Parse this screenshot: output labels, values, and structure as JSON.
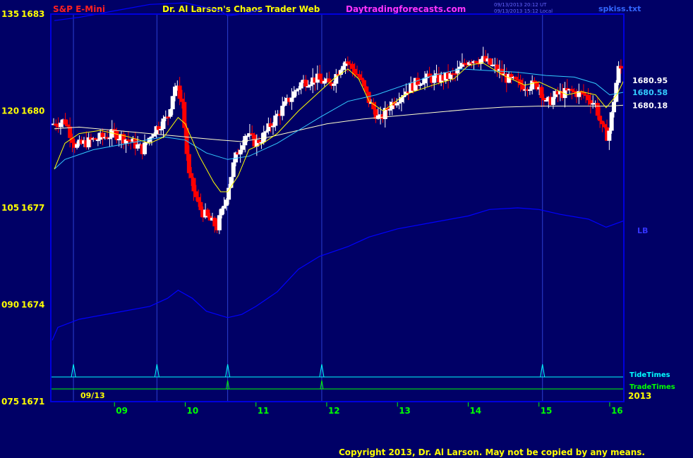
{
  "header": {
    "symbol": "S&P E-Mini",
    "title": "Dr. Al Larson's Chaos Trader Web",
    "website": "Daytradingforecasts.com",
    "timestamp_utc": "09/13/2013 20:12 UT",
    "timestamp_local": "09/13/2013 15:12 Local",
    "filename": "spkiss.txt"
  },
  "footer": {
    "copyright": "Copyright 2013, Dr. Al Larson. May not be copied by any means."
  },
  "chart_data": {
    "type": "candlestick",
    "date_label": "09/13",
    "year_label": "2013",
    "x_range": [
      8.1,
      16.2
    ],
    "x_ticks": [
      {
        "value": 9,
        "label": "09"
      },
      {
        "value": 10,
        "label": "10"
      },
      {
        "value": 11,
        "label": "11"
      },
      {
        "value": 12,
        "label": "12"
      },
      {
        "value": 13,
        "label": "13"
      },
      {
        "value": 14,
        "label": "14"
      },
      {
        "value": 15,
        "label": "15"
      },
      {
        "value": 16,
        "label": "16"
      }
    ],
    "y_range": [
      1671,
      1683
    ],
    "y_ticks": [
      {
        "value": 1683,
        "osc": "135",
        "price": "1683"
      },
      {
        "value": 1680,
        "osc": "120",
        "price": "1680"
      },
      {
        "value": 1677,
        "osc": "105",
        "price": "1677"
      },
      {
        "value": 1674,
        "osc": "090",
        "price": "1674"
      },
      {
        "value": 1671,
        "osc": "075",
        "price": "1671"
      }
    ],
    "colors": {
      "background": "#000066",
      "up_bar": "#ffffff",
      "down_bar": "#ff0000",
      "ma_fast": "#ffff00",
      "ma_mid": "#33ccff",
      "ma_slow": "#ffffcc",
      "oscillator": "#0000ff",
      "tide_times": "#00ffff",
      "trade_times": "#00ff00",
      "axis_green": "#00ff00",
      "axis_yellow": "#ffff00"
    },
    "vertical_lines_x": [
      8.42,
      9.6,
      10.6,
      11.93,
      15.05
    ],
    "tide_times": [
      8.42,
      9.6,
      10.6,
      11.93,
      15.05
    ],
    "trade_times": [
      10.6,
      11.93
    ],
    "tide_label": "TideTimes",
    "trade_label": "TradeTimes",
    "ma_labels": [
      {
        "text": "1680.95",
        "price": 1680.95,
        "color": "#ffffff"
      },
      {
        "text": "1680.58",
        "price": 1680.58,
        "color": "#33ccff"
      },
      {
        "text": "1680.18",
        "price": 1680.18,
        "color": "#ffffff"
      }
    ],
    "oscillator_label": "LB",
    "oscillator_label_price": 1676.3,
    "upper_band": [
      [
        8.15,
        1682.8
      ],
      [
        8.5,
        1682.9
      ],
      [
        9.0,
        1683.1
      ],
      [
        9.5,
        1683.3
      ],
      [
        10.0,
        1683.35
      ],
      [
        10.5,
        1683.1
      ],
      [
        10.6,
        1682.95
      ],
      [
        10.8,
        1683.0
      ],
      [
        11.1,
        1683.15
      ]
    ],
    "oscillator": [
      [
        8.12,
        1672.9
      ],
      [
        8.2,
        1673.3
      ],
      [
        8.5,
        1673.55
      ],
      [
        9.0,
        1673.75
      ],
      [
        9.5,
        1673.95
      ],
      [
        9.75,
        1674.2
      ],
      [
        9.9,
        1674.45
      ],
      [
        10.1,
        1674.2
      ],
      [
        10.3,
        1673.8
      ],
      [
        10.6,
        1673.6
      ],
      [
        10.8,
        1673.7
      ],
      [
        11.0,
        1673.95
      ],
      [
        11.3,
        1674.4
      ],
      [
        11.6,
        1675.1
      ],
      [
        11.9,
        1675.5
      ],
      [
        12.3,
        1675.8
      ],
      [
        12.6,
        1676.1
      ],
      [
        13.0,
        1676.35
      ],
      [
        13.5,
        1676.55
      ],
      [
        14.0,
        1676.75
      ],
      [
        14.3,
        1676.95
      ],
      [
        14.7,
        1677.0
      ],
      [
        15.0,
        1676.95
      ],
      [
        15.3,
        1676.8
      ],
      [
        15.7,
        1676.65
      ],
      [
        15.95,
        1676.4
      ],
      [
        16.2,
        1676.6
      ]
    ],
    "ma_fast": [
      [
        8.15,
        1678.2
      ],
      [
        8.3,
        1679.0
      ],
      [
        8.5,
        1679.3
      ],
      [
        8.8,
        1679.4
      ],
      [
        9.2,
        1679.2
      ],
      [
        9.5,
        1679.0
      ],
      [
        9.7,
        1679.2
      ],
      [
        9.9,
        1679.8
      ],
      [
        10.0,
        1679.6
      ],
      [
        10.2,
        1678.6
      ],
      [
        10.4,
        1677.8
      ],
      [
        10.5,
        1677.5
      ],
      [
        10.6,
        1677.5
      ],
      [
        10.75,
        1678.0
      ],
      [
        10.9,
        1678.8
      ],
      [
        11.1,
        1679.0
      ],
      [
        11.3,
        1679.3
      ],
      [
        11.6,
        1680.0
      ],
      [
        11.9,
        1680.6
      ],
      [
        12.1,
        1681.0
      ],
      [
        12.3,
        1681.3
      ],
      [
        12.45,
        1681.0
      ],
      [
        12.6,
        1680.3
      ],
      [
        12.8,
        1680.0
      ],
      [
        13.1,
        1680.5
      ],
      [
        13.5,
        1680.8
      ],
      [
        13.8,
        1681.0
      ],
      [
        14.0,
        1681.4
      ],
      [
        14.2,
        1681.5
      ],
      [
        14.5,
        1681.1
      ],
      [
        14.8,
        1680.8
      ],
      [
        15.0,
        1680.9
      ],
      [
        15.2,
        1680.7
      ],
      [
        15.4,
        1680.5
      ],
      [
        15.6,
        1680.6
      ],
      [
        15.8,
        1680.5
      ],
      [
        15.95,
        1680.1
      ],
      [
        16.1,
        1680.5
      ],
      [
        16.2,
        1680.95
      ]
    ],
    "ma_mid": [
      [
        8.15,
        1678.2
      ],
      [
        8.3,
        1678.5
      ],
      [
        8.7,
        1678.8
      ],
      [
        9.2,
        1679.0
      ],
      [
        9.7,
        1679.2
      ],
      [
        10.0,
        1679.1
      ],
      [
        10.3,
        1678.7
      ],
      [
        10.6,
        1678.5
      ],
      [
        10.9,
        1678.6
      ],
      [
        11.3,
        1679.0
      ],
      [
        11.6,
        1679.4
      ],
      [
        11.9,
        1679.8
      ],
      [
        12.3,
        1680.3
      ],
      [
        12.7,
        1680.5
      ],
      [
        13.1,
        1680.8
      ],
      [
        13.5,
        1681.1
      ],
      [
        13.9,
        1681.3
      ],
      [
        14.3,
        1681.25
      ],
      [
        14.7,
        1681.2
      ],
      [
        15.1,
        1681.1
      ],
      [
        15.5,
        1681.05
      ],
      [
        15.8,
        1680.85
      ],
      [
        16.0,
        1680.5
      ],
      [
        16.2,
        1680.58
      ]
    ],
    "ma_slow": [
      [
        8.15,
        1679.45
      ],
      [
        8.5,
        1679.5
      ],
      [
        9.0,
        1679.4
      ],
      [
        9.5,
        1679.3
      ],
      [
        10.0,
        1679.2
      ],
      [
        10.5,
        1679.1
      ],
      [
        10.8,
        1679.05
      ],
      [
        11.2,
        1679.2
      ],
      [
        11.6,
        1679.4
      ],
      [
        12.0,
        1679.6
      ],
      [
        12.5,
        1679.75
      ],
      [
        13.0,
        1679.85
      ],
      [
        13.5,
        1679.95
      ],
      [
        14.0,
        1680.05
      ],
      [
        14.5,
        1680.12
      ],
      [
        15.0,
        1680.15
      ],
      [
        15.5,
        1680.15
      ],
      [
        16.0,
        1680.15
      ],
      [
        16.2,
        1680.18
      ]
    ]
  }
}
